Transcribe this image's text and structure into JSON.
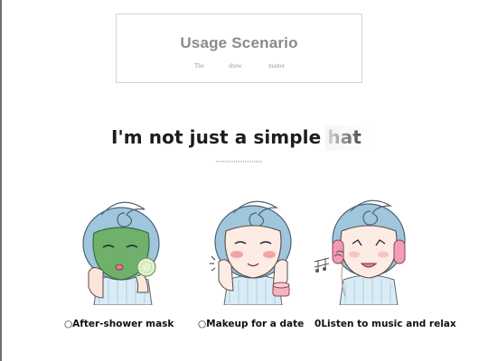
{
  "section": {
    "title": "Usage Scenario",
    "subtitle_words": [
      "The",
      "show",
      "matter"
    ]
  },
  "headline": "I'm not just a simple hat",
  "scenarios": [
    {
      "marker": "○",
      "caption": "After-shower mask",
      "icon": "green-face-mask-illustration"
    },
    {
      "marker": "○",
      "caption": "Makeup for a date",
      "icon": "makeup-date-illustration"
    },
    {
      "marker": "0",
      "caption": "Listen to music and relax",
      "icon": "headphones-music-illustration"
    }
  ],
  "colors": {
    "towel_blue": "#9fc6dd",
    "mask_green": "#6fb06b",
    "blush_pink": "#f4a4a4",
    "earmuff_pink": "#f29cb5",
    "cheek_pink": "#f6c5c5",
    "cream_pink": "#f3b4c0"
  }
}
